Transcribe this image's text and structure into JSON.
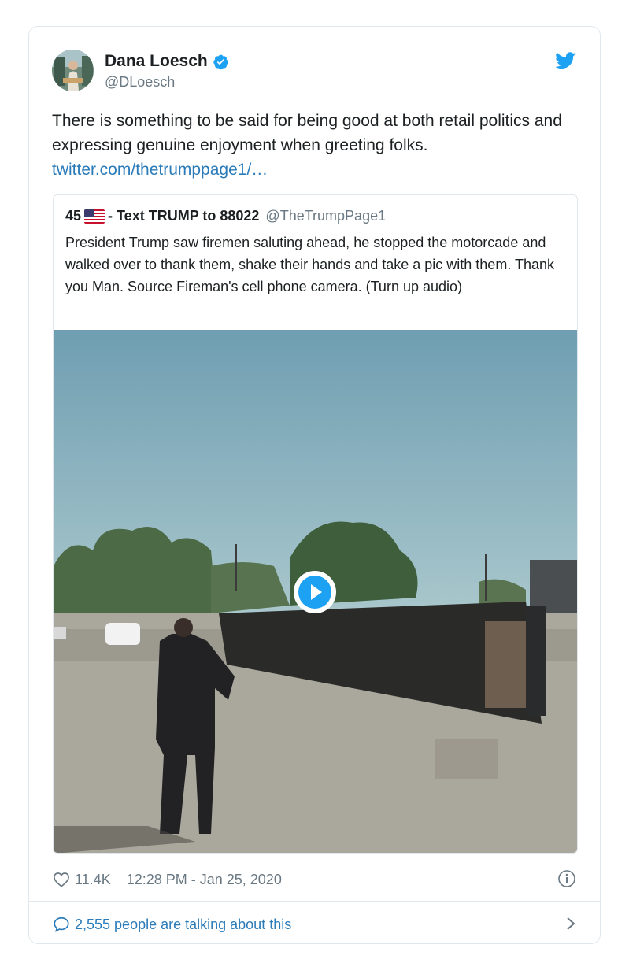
{
  "author": {
    "name": "Dana Loesch",
    "handle": "@DLoesch",
    "verified": true
  },
  "tweet": {
    "text": "There is something to be said for being good at both retail politics and expressing genuine enjoyment when greeting folks.",
    "link": "twitter.com/thetrumppage1/…"
  },
  "quoted": {
    "name_prefix": "45",
    "name_suffix": "- Text TRUMP to 88022",
    "handle": "@TheTrumpPage1",
    "text": "President Trump saw firemen saluting ahead, he stopped the motorcade and walked over to thank them, shake their hands and take a pic with them. Thank you Man. Source Fireman's cell phone camera. (Turn up audio)",
    "media_icon": "play-icon"
  },
  "footer": {
    "likes": "11.4K",
    "timestamp": "12:28 PM - Jan 25, 2020"
  },
  "conversation": {
    "label": "2,555 people are talking about this"
  },
  "colors": {
    "link": "#2b7bb9",
    "verified": "#1da1f2",
    "secondary": "#697882"
  }
}
